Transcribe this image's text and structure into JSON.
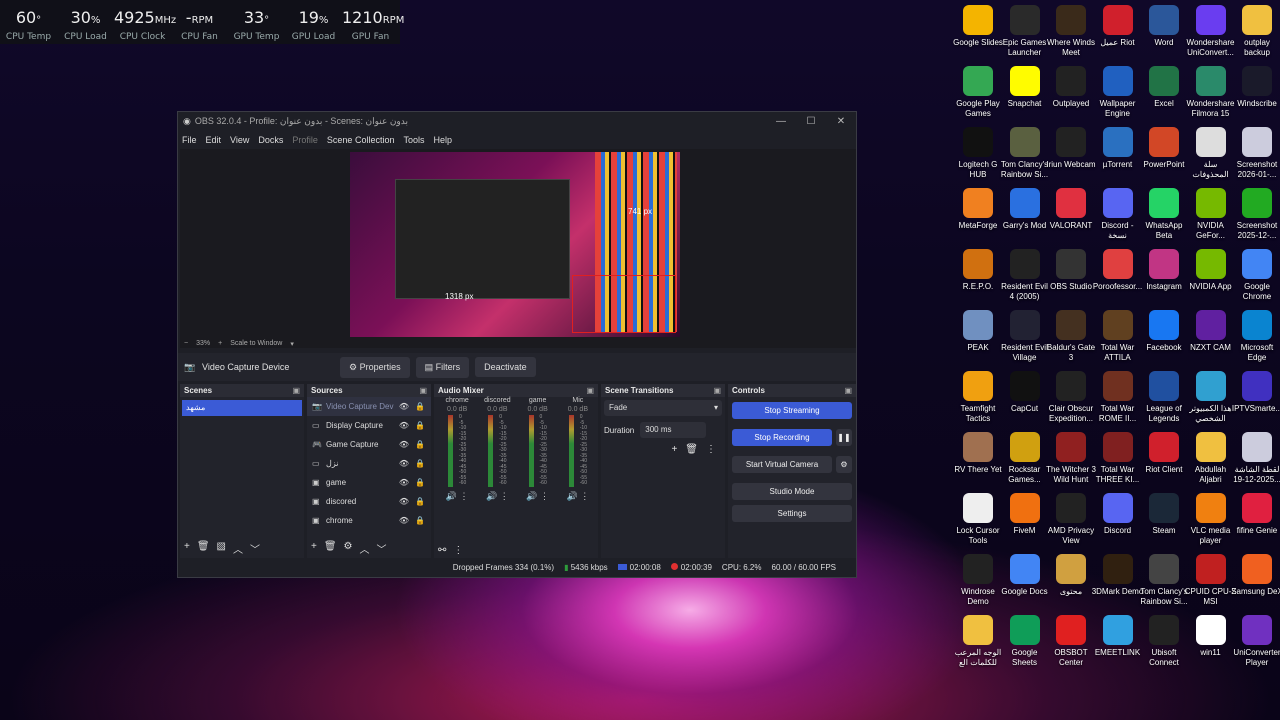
{
  "monitor": [
    {
      "value": "60",
      "unit": "°",
      "label": "CPU Temp"
    },
    {
      "value": "30",
      "unit": "%",
      "label": "CPU Load"
    },
    {
      "value": "4925",
      "unit": "MHz",
      "label": "CPU Clock"
    },
    {
      "value": "-",
      "unit": "RPM",
      "label": "CPU Fan"
    },
    {
      "value": "33",
      "unit": "°",
      "label": "GPU Temp"
    },
    {
      "value": "19",
      "unit": "%",
      "label": "GPU Load"
    },
    {
      "value": "1210",
      "unit": "RPM",
      "label": "GPU Fan"
    }
  ],
  "obs": {
    "title": "OBS 32.0.4 - Profile: بدون عنوان - Scenes: بدون عنوان",
    "menu": [
      "File",
      "Edit",
      "View",
      "Docks",
      "Profile",
      "Scene Collection",
      "Tools",
      "Help"
    ],
    "preview_labels": {
      "left": "1318 px",
      "right": "741 px"
    },
    "zoom": "33%",
    "scale_mode": "Scale to Window",
    "source_bar": {
      "device": "Video Capture Device",
      "properties": "Properties",
      "filters": "Filters",
      "deactivate": "Deactivate"
    },
    "scenes": {
      "title": "Scenes",
      "items": [
        "مشهد"
      ]
    },
    "sources": {
      "title": "Sources",
      "items": [
        {
          "name": "Video Capture Dev",
          "icon": "camera-icon"
        },
        {
          "name": "Display Capture",
          "icon": "monitor-icon"
        },
        {
          "name": "Game Capture",
          "icon": "gamepad-icon"
        },
        {
          "name": "نزل",
          "icon": "monitor-icon"
        },
        {
          "name": "game",
          "icon": "audio-icon"
        },
        {
          "name": "discored",
          "icon": "audio-icon"
        },
        {
          "name": "chrome",
          "icon": "audio-icon"
        }
      ]
    },
    "mixer": {
      "title": "Audio Mixer",
      "channels": [
        {
          "name": "chrome",
          "db": "0.0 dB"
        },
        {
          "name": "discored",
          "db": "0.0 dB"
        },
        {
          "name": "game",
          "db": "0.0 dB"
        },
        {
          "name": "Mic",
          "db": "0.0 dB"
        }
      ],
      "scale": [
        "0",
        "-5",
        "-10",
        "-15",
        "-20",
        "-25",
        "-30",
        "-35",
        "-40",
        "-45",
        "-50",
        "-55",
        "-60"
      ]
    },
    "transitions": {
      "title": "Scene Transitions",
      "type": "Fade",
      "duration_label": "Duration",
      "duration": "300 ms"
    },
    "controls": {
      "title": "Controls",
      "stop_streaming": "Stop Streaming",
      "stop_recording": "Stop Recording",
      "virtual_cam": "Start Virtual Camera",
      "studio": "Studio Mode",
      "settings": "Settings"
    },
    "status": {
      "dropped": "Dropped Frames 334 (0.1%)",
      "bitrate": "5436 kbps",
      "stream_time": "02:00:08",
      "rec_time": "02:00:39",
      "cpu": "CPU: 6.2%",
      "fps": "60.00 / 60.00 FPS"
    }
  },
  "desktop": [
    [
      "Google Slides",
      "Epic Games Launcher",
      "Where Winds Meet",
      "عميل Riot",
      "Word",
      "Wondershare UniConvert...",
      "outplay backup"
    ],
    [
      "Google Play Games",
      "Snapchat",
      "Outplayed",
      "Wallpaper Engine",
      "Excel",
      "Wondershare Filmora 15",
      "Windscribe"
    ],
    [
      "Logitech G HUB",
      "Tom Clancy's Rainbow Si...",
      "Iriun Webcam",
      "µTorrent",
      "PowerPoint",
      "سلة المحذوفات",
      "Screenshot 2026-01-..."
    ],
    [
      "MetaForge",
      "Garry's Mod",
      "VALORANT",
      "Discord - نسخة",
      "WhatsApp Beta",
      "NVIDIA GeFor...",
      "Screenshot 2025-12-..."
    ],
    [
      "R.E.P.O.",
      "Resident Evil 4 (2005)",
      "OBS Studio",
      "Poroofessor...",
      "Instagram",
      "NVIDIA App",
      "Google Chrome"
    ],
    [
      "PEAK",
      "Resident Evil Village",
      "Baldur's Gate 3",
      "Total War ATTILA",
      "Facebook",
      "NZXT CAM",
      "Microsoft Edge"
    ],
    [
      "Teamfight Tactics",
      "CapCut",
      "Clair Obscur Expedition...",
      "Total War ROME II...",
      "League of Legends",
      "هذا الكمبيوتر الشخصي",
      "IPTVSmarte..."
    ],
    [
      "RV There Yet",
      "Rockstar Games...",
      "The Witcher 3 Wild Hunt",
      "Total War THREE KI...",
      "Riot Client",
      "Abdullah Aljabri",
      "لقطة الشاشة 2025-12-19..."
    ],
    [
      "Lock Cursor Tools",
      "FiveM",
      "AMD Privacy View",
      "Discord",
      "Steam",
      "VLC media player",
      "fifine Genie"
    ],
    [
      "Windrose Demo",
      "Google Docs",
      "محتوى",
      "3DMark Demo",
      "Tom Clancy's Rainbow Si...",
      "CPUID CPU-Z MSI",
      "Samsung DeX"
    ],
    [
      "الوجه المرعب للكلمات الع",
      "Google Sheets",
      "OBSBOT Center",
      "EMEETLINK",
      "Ubisoft Connect",
      "win11",
      "UniConverter Player"
    ]
  ],
  "icon_colors": [
    [
      "#f4b400",
      "#2a2a2a",
      "#3a2a1a",
      "#d0202c",
      "#2b579a",
      "#6a3df0",
      "#f0c040"
    ],
    [
      "#34a853",
      "#fffc00",
      "#222",
      "#2060c0",
      "#217346",
      "#2a8a6a",
      "#1a1a2a"
    ],
    [
      "#111",
      "#5a6040",
      "#222",
      "#2a70c0",
      "#d24726",
      "#ddd",
      "#ccd"
    ],
    [
      "#f08020",
      "#2a70e0",
      "#e03040",
      "#5865f2",
      "#25d366",
      "#76b900",
      "#2a2"
    ],
    [
      "#d07010",
      "#222",
      "#333",
      "#e04040",
      "#c13584",
      "#76b900",
      "#4285f4"
    ],
    [
      "#7090c0",
      "#223",
      "#443020",
      "#604020",
      "#1877f2",
      "#6020a0",
      "#0a84d0"
    ],
    [
      "#f0a010",
      "#111",
      "#222",
      "#703020",
      "#2050a0",
      "#30a0d0",
      "#4030c0"
    ],
    [
      "#a07050",
      "#d0a010",
      "#902020",
      "#802020",
      "#d0202c",
      "#f0c040",
      "#ccd"
    ],
    [
      "#eee",
      "#f07010",
      "#222",
      "#5865f2",
      "#1b2838",
      "#f08010",
      "#e02040"
    ],
    [
      "#222",
      "#4285f4",
      "#d0a040",
      "#302010",
      "#444",
      "#c02020",
      "#f06020"
    ],
    [
      "#f0c040",
      "#0f9d58",
      "#e02020",
      "#30a0e0",
      "#222",
      "#fff",
      "#7030c0"
    ]
  ]
}
